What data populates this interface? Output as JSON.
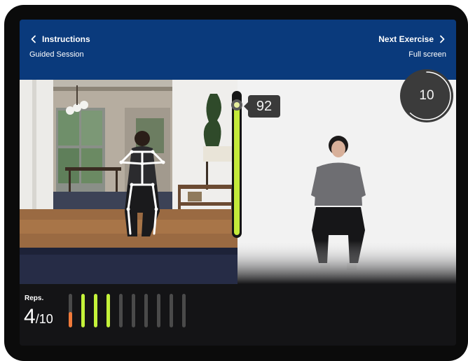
{
  "header": {
    "back_label": "Instructions",
    "session_label": "Guided Session",
    "next_label": "Next Exercise",
    "fullscreen_label": "Full screen"
  },
  "form_meter": {
    "score": "92",
    "level": 0.92,
    "color": "#c4ea3a"
  },
  "timer": {
    "value": "10",
    "remaining_fraction": 0.62
  },
  "reps": {
    "label": "Reps.",
    "current": "4",
    "total": "/10",
    "bars": [
      {
        "fill": 0.45,
        "color": "#f07a3a"
      },
      {
        "fill": 1.0,
        "color": "#c4f23a"
      },
      {
        "fill": 1.0,
        "color": "#c4f23a"
      },
      {
        "fill": 1.0,
        "color": "#c4f23a"
      },
      {
        "fill": 0,
        "color": "#4a4a4a"
      },
      {
        "fill": 0,
        "color": "#4a4a4a"
      },
      {
        "fill": 0,
        "color": "#4a4a4a"
      },
      {
        "fill": 0,
        "color": "#4a4a4a"
      },
      {
        "fill": 0,
        "color": "#4a4a4a"
      },
      {
        "fill": 0,
        "color": "#4a4a4a"
      }
    ]
  },
  "colors": {
    "header_bg": "#0a3a7c",
    "accent": "#c4ea3a"
  }
}
